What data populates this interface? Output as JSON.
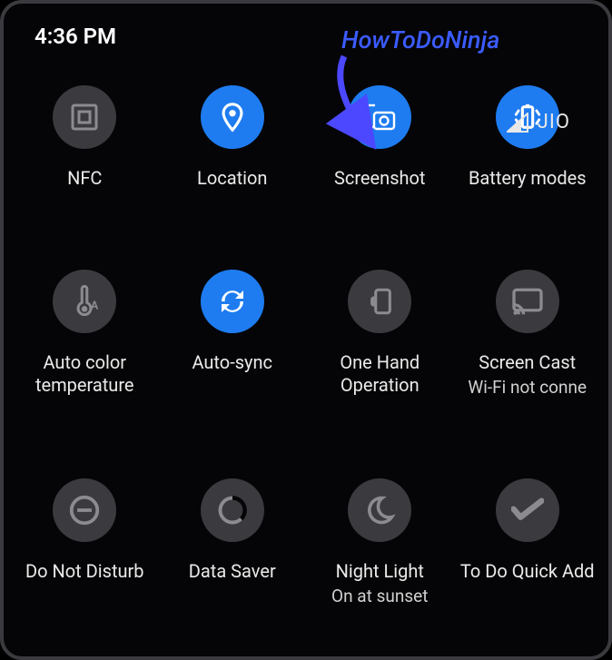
{
  "status": {
    "time": "4:36 PM",
    "carrier": "JIO"
  },
  "annotation": {
    "text": "HowToDoNinja"
  },
  "tiles": [
    {
      "label": "NFC",
      "sub": "",
      "active": false,
      "icon": "nfc"
    },
    {
      "label": "Location",
      "sub": "",
      "active": true,
      "icon": "location"
    },
    {
      "label": "Screenshot",
      "sub": "",
      "active": true,
      "icon": "screenshot"
    },
    {
      "label": "Battery modes",
      "sub": "",
      "active": true,
      "icon": "battery"
    },
    {
      "label": "Auto color temperature",
      "sub": "",
      "active": false,
      "icon": "autotemp"
    },
    {
      "label": "Auto-sync",
      "sub": "",
      "active": true,
      "icon": "sync"
    },
    {
      "label": "One Hand Operation",
      "sub": "",
      "active": false,
      "icon": "onehand"
    },
    {
      "label": "Screen Cast",
      "sub": "Wi-Fi not conne",
      "active": false,
      "icon": "cast"
    },
    {
      "label": "Do Not Disturb",
      "sub": "",
      "active": false,
      "icon": "dnd"
    },
    {
      "label": "Data Saver",
      "sub": "",
      "active": false,
      "icon": "datasaver"
    },
    {
      "label": "Night Light",
      "sub": "On at sunset",
      "active": false,
      "icon": "night"
    },
    {
      "label": "To Do Quick Add",
      "sub": "",
      "active": false,
      "icon": "todo"
    }
  ]
}
